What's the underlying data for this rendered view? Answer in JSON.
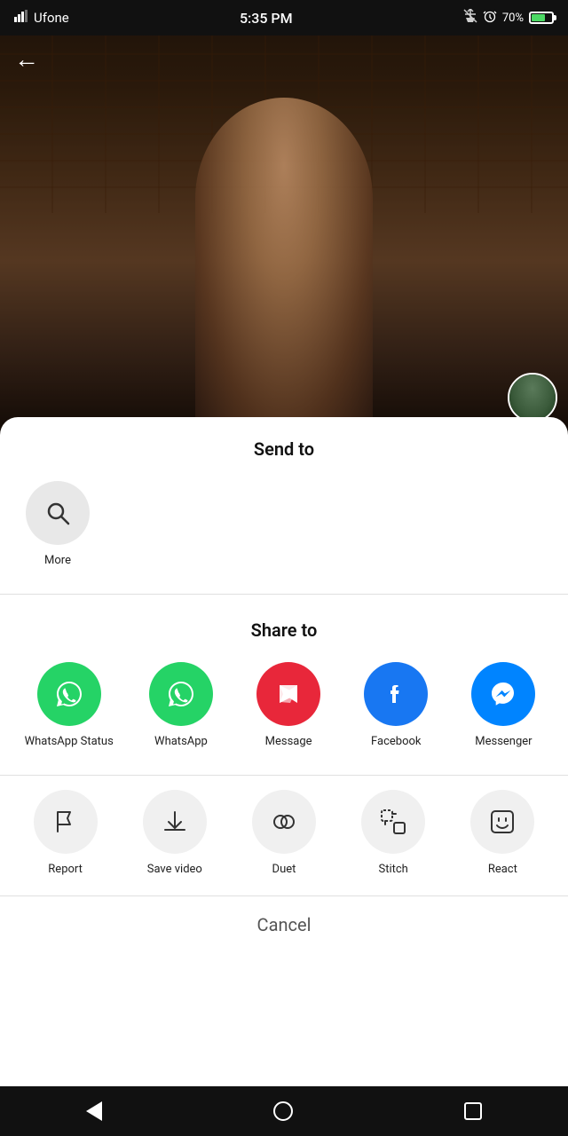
{
  "statusBar": {
    "carrier": "Ufone",
    "time": "5:35 PM",
    "battery": "70%"
  },
  "backButton": "←",
  "sheet": {
    "sendToTitle": "Send to",
    "shareToTitle": "Share to",
    "moreLabel": "More",
    "cancelLabel": "Cancel",
    "shareItems": [
      {
        "id": "whatsapp-status",
        "label": "WhatsApp Status",
        "type": "whatsapp"
      },
      {
        "id": "whatsapp",
        "label": "WhatsApp",
        "type": "whatsapp"
      },
      {
        "id": "message",
        "label": "Message",
        "type": "message"
      },
      {
        "id": "facebook",
        "label": "Facebook",
        "type": "facebook"
      },
      {
        "id": "messenger",
        "label": "Messenger",
        "type": "messenger"
      }
    ],
    "actionItems": [
      {
        "id": "report",
        "label": "Report",
        "icon": "flag"
      },
      {
        "id": "save-video",
        "label": "Save video",
        "icon": "download"
      },
      {
        "id": "duet",
        "label": "Duet",
        "icon": "duet"
      },
      {
        "id": "stitch",
        "label": "Stitch",
        "icon": "stitch"
      },
      {
        "id": "react",
        "label": "React",
        "icon": "react"
      }
    ]
  }
}
